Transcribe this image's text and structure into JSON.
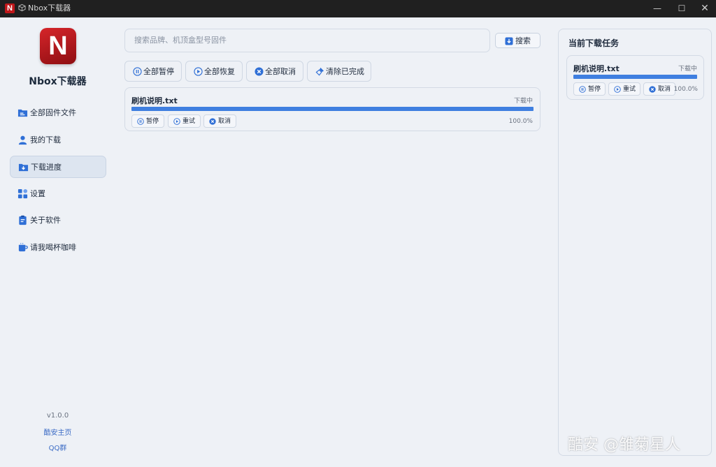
{
  "window": {
    "title": "Nbox下载器",
    "logo_letter": "N"
  },
  "sidebar": {
    "app_name": "Nbox下载器",
    "logo_letter": "N",
    "items": [
      {
        "label": "全部固件文件",
        "icon": "folder-list-icon",
        "active": false
      },
      {
        "label": "我的下载",
        "icon": "user-icon",
        "active": false
      },
      {
        "label": "下载进度",
        "icon": "download-box-icon",
        "active": true
      },
      {
        "label": "设置",
        "icon": "settings-grid-icon",
        "active": false
      },
      {
        "label": "关于软件",
        "icon": "clipboard-icon",
        "active": false
      },
      {
        "label": "请我喝杯咖啡",
        "icon": "coffee-icon",
        "active": false
      }
    ],
    "version": "v1.0.0",
    "homepage_link": "酷安主页",
    "qq_link": "QQ群"
  },
  "search": {
    "placeholder": "搜索品牌、机顶盒型号固件",
    "value": "",
    "button_label": "搜索"
  },
  "actions": {
    "pause_all": "全部暂停",
    "resume_all": "全部恢复",
    "cancel_all": "全部取消",
    "clear_done": "清除已完成"
  },
  "main_tasks": [
    {
      "name": "刷机说明.txt",
      "status": "下载中",
      "progress": 100.0,
      "progress_label": "100.0%",
      "pause": "暂停",
      "retry": "重试",
      "cancel": "取消"
    }
  ],
  "right_panel": {
    "title": "当前下载任务",
    "tasks": [
      {
        "name": "刷机说明.txt",
        "status": "下载中",
        "progress": 100.0,
        "progress_label": "100.0%",
        "pause": "暂停",
        "retry": "重试",
        "cancel": "取消"
      }
    ]
  },
  "watermark": "酷安 @雏菊星人",
  "colors": {
    "accent": "#3f7fe0",
    "logo_red": "#c0171a",
    "link": "#3c6cc5",
    "background": "#eef1f6"
  }
}
